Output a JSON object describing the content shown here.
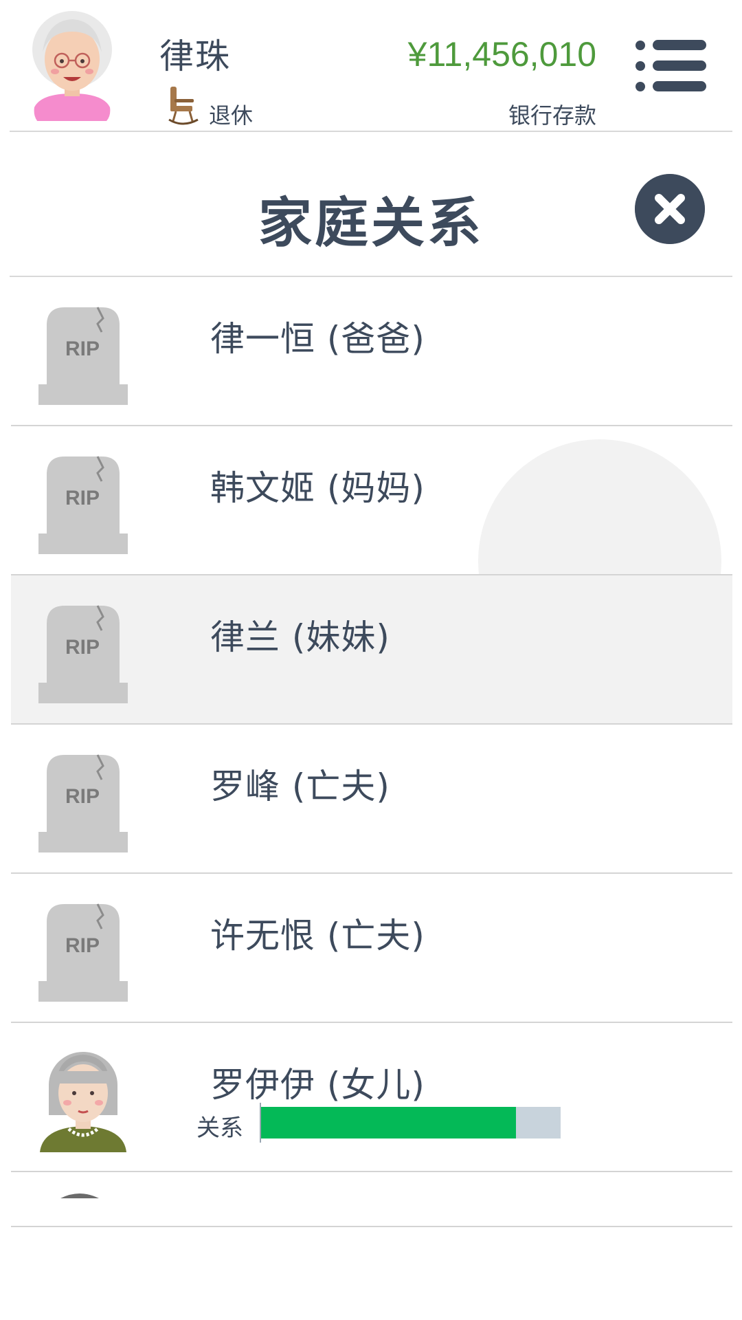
{
  "header": {
    "player_name": "律珠",
    "status_label": "退休",
    "money": "¥11,456,010",
    "money_label": "银行存款"
  },
  "title": "家庭关系",
  "relations": [
    {
      "name": "律一恒 (爸爸)",
      "deceased": true,
      "icon": "tombstone-icon",
      "icon_text": "RIP"
    },
    {
      "name": "韩文姬 (妈妈)",
      "deceased": true,
      "icon": "tombstone-icon",
      "icon_text": "RIP"
    },
    {
      "name": "律兰 (妹妹)",
      "deceased": true,
      "icon": "tombstone-icon",
      "icon_text": "RIP",
      "selected": true
    },
    {
      "name": "罗峰 (亡夫)",
      "deceased": true,
      "icon": "tombstone-icon",
      "icon_text": "RIP"
    },
    {
      "name": "许无恨 (亡夫)",
      "deceased": true,
      "icon": "tombstone-icon",
      "icon_text": "RIP"
    },
    {
      "name": "罗伊伊 (女儿)",
      "deceased": false,
      "icon": "elderly-woman-avatar",
      "relation_label": "关系",
      "relation_level": 0.85
    }
  ],
  "colors": {
    "text": "#3d4a5c",
    "money": "#4e9a3c",
    "relation_fill": "#04b957",
    "relation_track": "#c8d3dc",
    "tombstone": "#c9c9c9",
    "selected_row": "#f2f2f2"
  }
}
